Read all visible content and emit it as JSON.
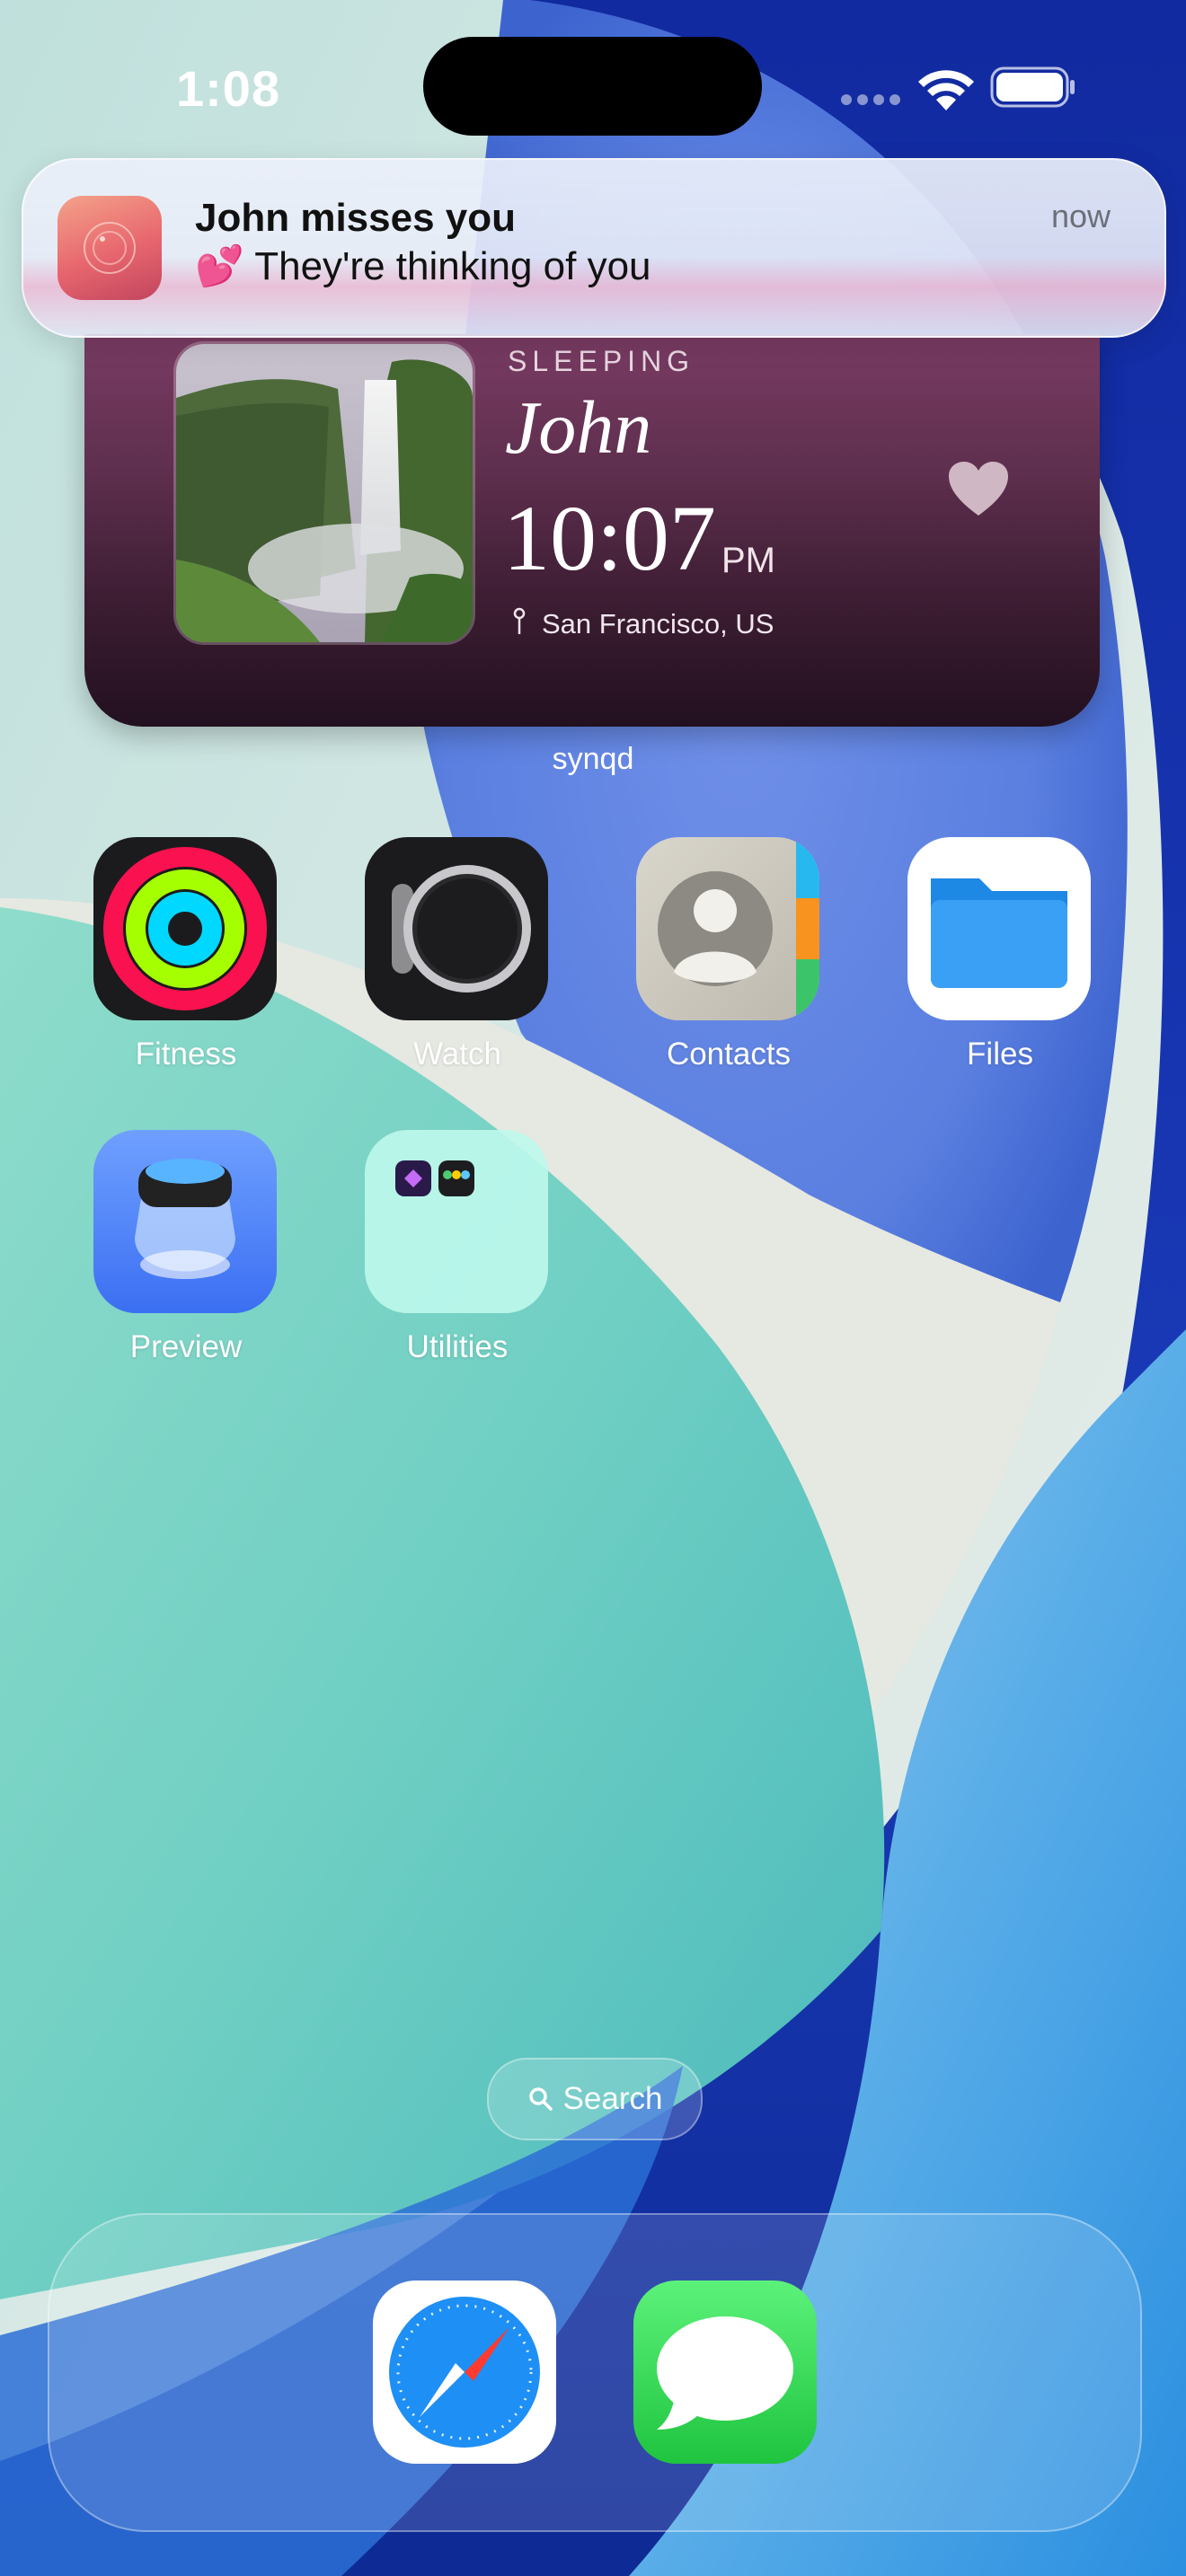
{
  "status_bar": {
    "time": "1:08"
  },
  "notification": {
    "title": "John misses you",
    "body": "💕 They're thinking of you",
    "time": "now"
  },
  "widget": {
    "status": "SLEEPING",
    "name": "John",
    "time": "10:07",
    "ampm": "PM",
    "location": "San Francisco, US",
    "caption": "synqd"
  },
  "apps": [
    {
      "label": "Fitness"
    },
    {
      "label": "Watch"
    },
    {
      "label": "Contacts"
    },
    {
      "label": "Files"
    },
    {
      "label": "Preview"
    },
    {
      "label": "Utilities"
    }
  ],
  "search": {
    "label": "Search"
  },
  "dock": [
    "Safari",
    "Messages"
  ]
}
